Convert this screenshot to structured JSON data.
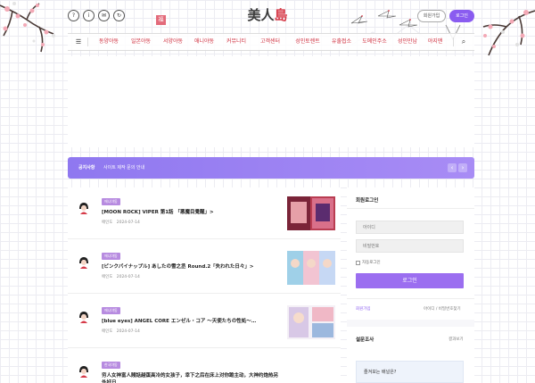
{
  "header": {
    "logo_part1": "美人",
    "logo_part2": "島",
    "stamp_text": "福",
    "icon_buttons": [
      {
        "icon": "question-icon",
        "glyph": "?"
      },
      {
        "icon": "info-icon",
        "glyph": "i"
      },
      {
        "icon": "bookmark-icon",
        "glyph": "✉"
      },
      {
        "icon": "refresh-icon",
        "glyph": "↻"
      }
    ],
    "signup_label": "회원가입",
    "login_label": "로그인"
  },
  "nav": {
    "menu_icon": "☰",
    "items": [
      "동양야동",
      "일본야동",
      "서양야동",
      "애니야동",
      "커뮤니티",
      "고객센터",
      "성인토렌트",
      "유출접소",
      "도메인주소",
      "성인만남",
      "야지맨"
    ],
    "search_icon": "⌕"
  },
  "notice": {
    "label": "공지사항",
    "text": "사이트 제작 문의 안내",
    "prev": "‹",
    "next": "›"
  },
  "posts": [
    {
      "badge": "애니야동",
      "title": "[MOON ROCK] VIPER 第1話 「悪魔目覺醒」>",
      "author": "애인도",
      "date": "2024-07-14"
    },
    {
      "badge": "애니야동",
      "title": "[ピンクパイナップル] あしたの雪之丞 Round.2「失われた日々」>",
      "author": "애인도",
      "date": "2024-07-14"
    },
    {
      "badge": "애니야동",
      "title": "[blue eyes] ANGEL CORE エンゼル・コア 〜天使たちの性処〜…",
      "author": "애인도",
      "date": "2024-07-14"
    },
    {
      "badge": "한국야동",
      "title": "穷人女神富人賤話越蛋高冷的女孩子，幸下之后在床上对你跪主动，大神约炮热另外好日",
      "author": "",
      "date": ""
    }
  ],
  "sidebar": {
    "login_title": "회원로그인",
    "id_placeholder": "아이디",
    "pw_placeholder": "비밀번호",
    "auto_login": "자동로그인",
    "login_button": "로그인",
    "signup_link": "회원가입",
    "find_link": "아이디 / 비밀번호찾기",
    "poll_title": "설문조사",
    "poll_more": "결과보기",
    "poll_question": "즐겨보는 배널은?"
  },
  "colors": {
    "accent": "#9b6ef0",
    "nav_text": "#d0303f",
    "badge": "#b78be0",
    "logo_red": "#d63a48"
  }
}
